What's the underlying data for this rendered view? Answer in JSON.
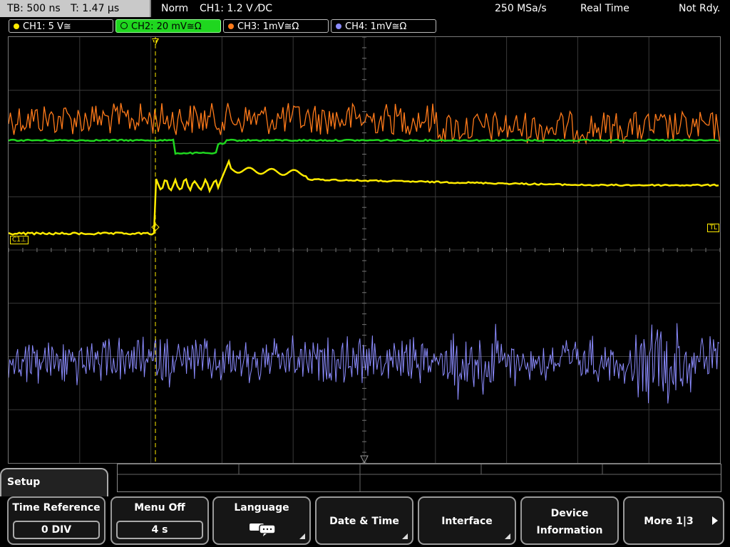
{
  "status": {
    "timebase": "TB: 500 ns",
    "trigger_time": "T: 1.47 µs",
    "mode": "Norm",
    "trigger": "CH1: 1.2 V ⁄DC",
    "sample_rate": "250 MSa/s",
    "acquisition": "Real Time",
    "state": "Not Rdy."
  },
  "channels": [
    {
      "label": "CH1: 5 V≅",
      "color": "#ffeb00"
    },
    {
      "label": "CH2: 20 mV≅Ω",
      "color": "#1fd61f"
    },
    {
      "label": "CH3: 1mV≅Ω",
      "color": "#ff7a1a"
    },
    {
      "label": "CH4: 1mV≅Ω",
      "color": "#8c8cff"
    }
  ],
  "markers": {
    "c1": "C1⊥",
    "tl": "TL",
    "trig": "T"
  },
  "menu": {
    "title": "Setup",
    "buttons": [
      {
        "label": "Time Reference",
        "value": "0 DIV"
      },
      {
        "label": "Menu Off",
        "value": "4 s"
      },
      {
        "label": "Language"
      },
      {
        "label": "Date & Time"
      },
      {
        "label": "Interface"
      },
      {
        "label": "Device",
        "label2": "Information"
      },
      {
        "label": "More 1|3"
      }
    ]
  }
}
